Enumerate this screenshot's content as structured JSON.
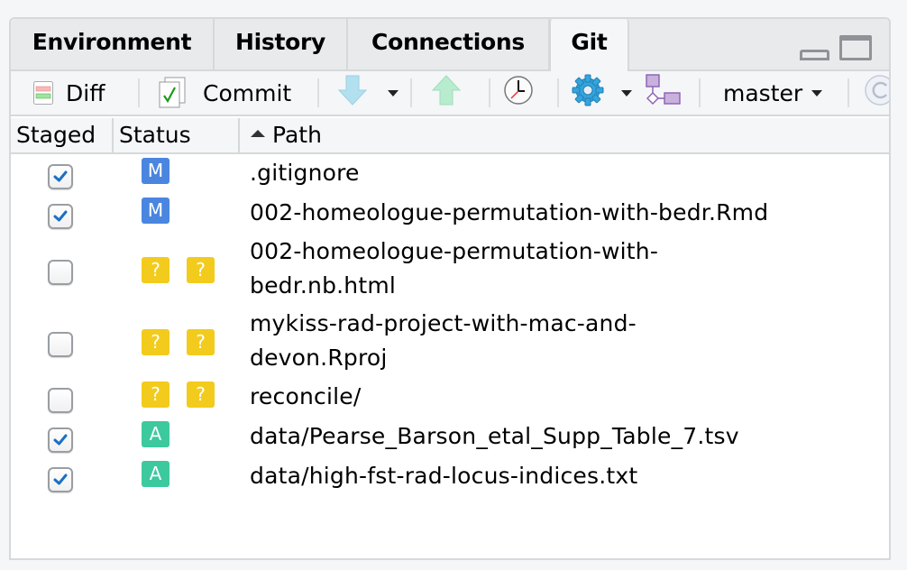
{
  "tabs": [
    {
      "label": "Environment",
      "active": false
    },
    {
      "label": "History",
      "active": false
    },
    {
      "label": "Connections",
      "active": false
    },
    {
      "label": "Git",
      "active": true
    }
  ],
  "toolbar": {
    "diff_label": "Diff",
    "commit_label": "Commit",
    "branch_label": "master"
  },
  "table": {
    "columns": [
      "Staged",
      "Status",
      "Path"
    ],
    "sort_column": "Path",
    "sort_direction": "ascending",
    "rows": [
      {
        "staged": true,
        "status": [
          "M"
        ],
        "path_lines": [
          ".gitignore"
        ]
      },
      {
        "staged": true,
        "status": [
          "M"
        ],
        "path_lines": [
          "002-homeologue-permutation-with-bedr.Rmd"
        ]
      },
      {
        "staged": false,
        "status": [
          "?",
          "?"
        ],
        "path_lines": [
          "002-homeologue-permutation-with-",
          "bedr.nb.html"
        ]
      },
      {
        "staged": false,
        "status": [
          "?",
          "?"
        ],
        "path_lines": [
          "mykiss-rad-project-with-mac-and-",
          "devon.Rproj"
        ]
      },
      {
        "staged": false,
        "status": [
          "?",
          "?"
        ],
        "path_lines": [
          "reconcile/"
        ]
      },
      {
        "staged": true,
        "status": [
          "A"
        ],
        "path_lines": [
          "data/Pearse_Barson_etal_Supp_Table_7.tsv"
        ]
      },
      {
        "staged": true,
        "status": [
          "A"
        ],
        "path_lines": [
          "data/high-fst-rad-locus-indices.txt"
        ]
      }
    ]
  },
  "colors": {
    "modified": "#4a86e0",
    "untracked": "#f2cb1d",
    "added": "#3cc99e",
    "check": "#1a6fc6"
  }
}
